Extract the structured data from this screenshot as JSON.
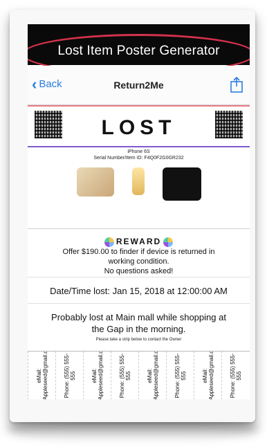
{
  "title_bar": {
    "title": "Lost Item Poster Generator"
  },
  "navbar": {
    "back_label": "Back",
    "title": "Return2Me"
  },
  "poster": {
    "headline": "LOST",
    "device_name": "iPhone 6S",
    "serial_line": "Serial Number/Item ID: F4Q0F2G0GR232",
    "reward_title": "REWARD",
    "reward_line1": "Offer $190.00 to finder if device is returned in",
    "reward_line2": "working condition.",
    "reward_line3": "No questions asked!",
    "datetime": "Date/Time lost: Jan 15, 2018 at 12:00:00 AM",
    "location_line1": "Probably lost at Main mall while shopping at",
    "location_line2": "the Gap in the morning.",
    "tabs_hint": "Please take a strip below to contact the Owner",
    "tabs": [
      "eMail: Appleseed@gmail.com",
      "Phone: (555) 555-555",
      "eMail: Appleseed@gmail.com",
      "Phone: (555) 555-555",
      "eMail: Appleseed@gmail.com",
      "Phone: (555) 555-555",
      "eMail: Appleseed@gmail.com",
      "Phone: (555) 555-555"
    ]
  },
  "colors": {
    "accent": "#2a7de1",
    "highlight": "#d3324c",
    "titlebar": "#0a0a0a"
  }
}
